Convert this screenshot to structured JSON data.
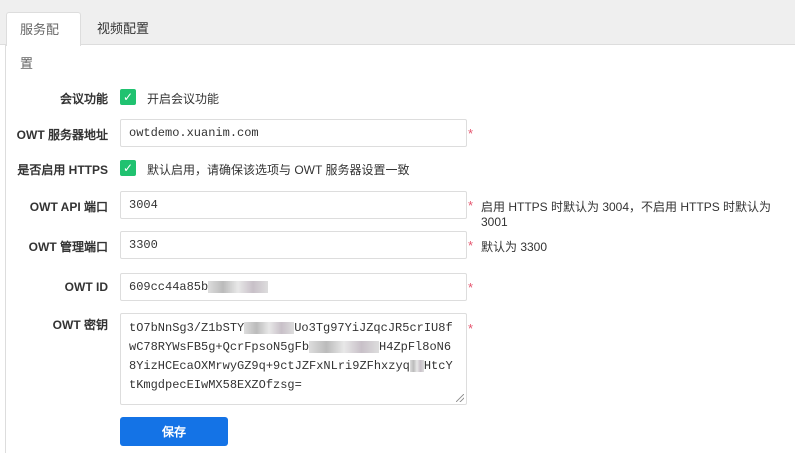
{
  "tabs": [
    {
      "label": "服务配置",
      "active": true
    },
    {
      "label": "视频配置",
      "active": false
    }
  ],
  "form": {
    "meeting": {
      "label": "会议功能",
      "checkbox_label": "开启会议功能",
      "checked": true
    },
    "server": {
      "label": "OWT 服务器地址",
      "value": "owtdemo.xuanim.com",
      "required": "*"
    },
    "https": {
      "label": "是否启用 HTTPS",
      "checkbox_label": "默认启用，请确保该选项与 OWT 服务器设置一致",
      "checked": true
    },
    "api_port": {
      "label": "OWT API 端口",
      "value": "3004",
      "required": "*",
      "hint": "启用 HTTPS 时默认为 3004，不启用 HTTPS 时默认为 3001"
    },
    "admin_port": {
      "label": "OWT 管理端口",
      "value": "3300",
      "required": "*",
      "hint": "默认为 3300"
    },
    "owt_id": {
      "label": "OWT ID",
      "value": "609cc44a85b",
      "required": "*"
    },
    "owt_key": {
      "label": "OWT 密钥",
      "lines": [
        "tO7bNnSg3/Z1bSTY",
        "Uo3Tg97YiJZqcJR5crIU8fwC78R",
        "YWsFB5g+QcrFpsoN5gFb",
        "H4ZpFl8oN68",
        "YizHCEcaOXMrwyGZ9q+9ctJZFxNLri9ZFhxzyq",
        "HtcYtKmgd",
        "pecEIwMX58EXZOfzsg="
      ],
      "required": "*"
    },
    "save_label": "保存"
  },
  "colors": {
    "accent": "#1473e6",
    "checkbox": "#20c270",
    "required": "#e5556e"
  }
}
